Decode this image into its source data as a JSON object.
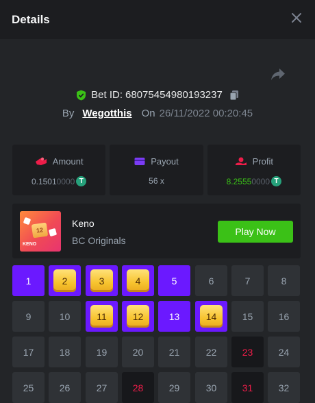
{
  "header": {
    "title": "Details"
  },
  "bet": {
    "label": "Bet ID:",
    "id": "68075454980193237",
    "by": "By",
    "user": "Wegotthis",
    "on": "On",
    "date": "26/11/2022 00:20:45"
  },
  "stats": {
    "amount": {
      "label": "Amount",
      "value_main": "0.1501",
      "value_dim": "0000"
    },
    "payout": {
      "label": "Payout",
      "value": "56 x"
    },
    "profit": {
      "label": "Profit",
      "value_main": "8.2555",
      "value_dim": "0000"
    }
  },
  "game": {
    "name": "Keno",
    "provider": "BC Originals",
    "play_label": "Play Now",
    "thumb_number": "12",
    "thumb_label": "KENO"
  },
  "colors": {
    "accent_green": "#3bc117",
    "select_purple": "#6b19ff",
    "drawn_red": "#ed1d49",
    "coin": "#26a17b"
  },
  "grid": {
    "cells": [
      {
        "n": "1",
        "s": "sel"
      },
      {
        "n": "2",
        "s": "hit"
      },
      {
        "n": "3",
        "s": "hit"
      },
      {
        "n": "4",
        "s": "hit"
      },
      {
        "n": "5",
        "s": "sel"
      },
      {
        "n": "6",
        "s": ""
      },
      {
        "n": "7",
        "s": ""
      },
      {
        "n": "8",
        "s": ""
      },
      {
        "n": "9",
        "s": ""
      },
      {
        "n": "10",
        "s": ""
      },
      {
        "n": "11",
        "s": "hit"
      },
      {
        "n": "12",
        "s": "hit"
      },
      {
        "n": "13",
        "s": "sel"
      },
      {
        "n": "14",
        "s": "hit"
      },
      {
        "n": "15",
        "s": ""
      },
      {
        "n": "16",
        "s": ""
      },
      {
        "n": "17",
        "s": ""
      },
      {
        "n": "18",
        "s": ""
      },
      {
        "n": "19",
        "s": ""
      },
      {
        "n": "20",
        "s": ""
      },
      {
        "n": "21",
        "s": ""
      },
      {
        "n": "22",
        "s": ""
      },
      {
        "n": "23",
        "s": "drawn"
      },
      {
        "n": "24",
        "s": ""
      },
      {
        "n": "25",
        "s": ""
      },
      {
        "n": "26",
        "s": ""
      },
      {
        "n": "27",
        "s": ""
      },
      {
        "n": "28",
        "s": "drawn"
      },
      {
        "n": "29",
        "s": ""
      },
      {
        "n": "30",
        "s": ""
      },
      {
        "n": "31",
        "s": "drawn"
      },
      {
        "n": "32",
        "s": ""
      }
    ]
  }
}
